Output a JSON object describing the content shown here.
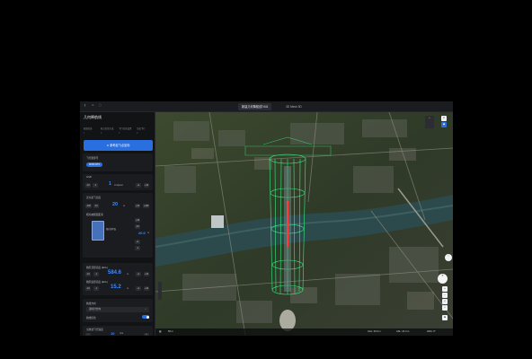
{
  "window": {
    "back_icon": "back-arrow",
    "tabs": [
      {
        "label": "新建几何降航线7441",
        "active": true
      },
      {
        "label": "3D Mesh 3D",
        "active": false
      }
    ]
  },
  "panel": {
    "title": "几何降航线",
    "steps": [
      {
        "label": "航线信息",
        "n": "1"
      },
      {
        "label": "航点信息生成",
        "n": "2"
      },
      {
        "label": "飞行信息设置",
        "n": "3"
      },
      {
        "label": "生成飞行",
        "n": "4"
      }
    ],
    "set_button": "参考起飞点坐标",
    "drone": {
      "label": "飞行器型号",
      "chip": "M350 RTK"
    },
    "gsd": {
      "label": "GSD",
      "minus10": "-10",
      "minus1": "-1",
      "value": "1",
      "unit": "cm/pixel",
      "plus1": "+1",
      "plus10": "+10"
    },
    "safe_height": {
      "label": "安全起飞高度",
      "minus100": "-100",
      "minus10": "-10",
      "value": "20",
      "unit": "m",
      "plus10": "+10",
      "plus100": "+100"
    },
    "sampling": {
      "label": "相对被摄面距离",
      "model_label": "相对参考面",
      "b1": "+10",
      "b2": "-10",
      "value": "20.0",
      "unit": "m",
      "b3": "+1",
      "b4": "-1"
    },
    "top_alt": {
      "label": "航区顶部高度 (EGL)",
      "minus10": "-10",
      "minus1": "-1",
      "value": "584.6",
      "unit": "m",
      "plus1": "+1",
      "plus10": "+10"
    },
    "bottom_alt": {
      "label": "航区底部高度 (EGL)",
      "minus10": "-10",
      "minus1": "-1",
      "value": "15.2",
      "unit": "m",
      "plus1": "+1",
      "plus10": "+10"
    },
    "direction": {
      "label": "航线方向",
      "value": "逆时针方向",
      "toggle_label": "航线优化",
      "toggle_on": true
    },
    "speed": {
      "label": "全航线飞行速度",
      "minus": "-",
      "value": "10",
      "unit": "m/s",
      "plus": "+"
    }
  },
  "status": {
    "scale": "50 m",
    "coord": "AGL: 30.9 m",
    "alt": "ASL: 22.3 m",
    "heading": "HDG: 0°"
  },
  "colors": {
    "accent": "#2a6fe0",
    "value_blue": "#3d8bff",
    "route_green": "#39ff88"
  }
}
